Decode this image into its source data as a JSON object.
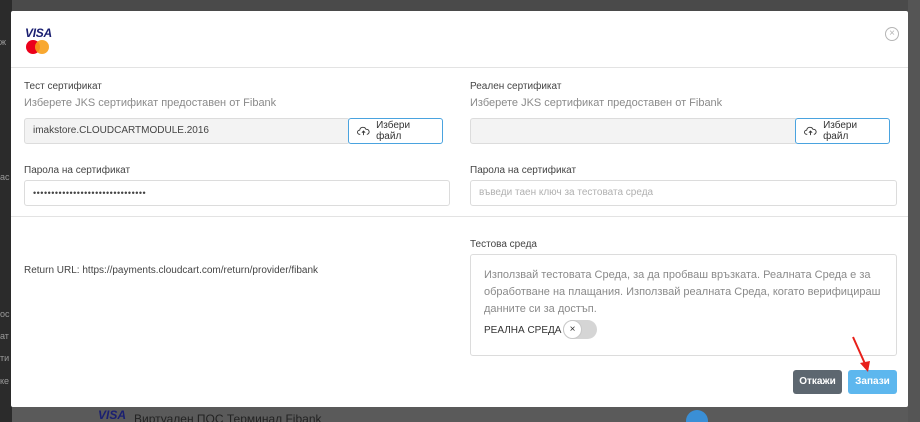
{
  "background": {
    "left_items": [
      "ж",
      "ас",
      "ос",
      "ат",
      "ти",
      "ке"
    ],
    "bottom_row": {
      "visa": "VISA",
      "label": "Виртуален ПОС Терминал Fibank"
    }
  },
  "header": {
    "logo_visa": "VISA",
    "logo_mastercard": "mastercard",
    "close_icon": "×"
  },
  "test_cert": {
    "label": "Тест сертификат",
    "hint": "Изберете JKS сертификат предоставен от Fibank",
    "file_value": "imakstore.CLOUDCARTMODULE.2016",
    "button_label": "Избери файл"
  },
  "real_cert": {
    "label": "Реален сертификат",
    "hint": "Изберете JKS сертификат предоставен от Fibank",
    "file_value": "",
    "button_label": "Избери файл"
  },
  "test_password": {
    "label": "Парола на сертификат",
    "value": "•••••••••••••••••••••••••••••••"
  },
  "real_password": {
    "label": "Парола на сертификат",
    "placeholder": "въведи таен ключ за тестовата среда"
  },
  "return_url": "Return URL: https://payments.cloudcart.com/return/provider/fibank",
  "environment": {
    "label": "Тестова среда",
    "description": "Използвай тестовата Среда, за да пробваш връзката. Реалната Среда е за обработване на плащания. Използвай реалната Среда, когато верифицираш данните си за достъп.",
    "toggle_label": "РЕАЛНА СРЕДА",
    "toggle_knob": "×",
    "toggle_on": false
  },
  "actions": {
    "cancel_label": "Откажи",
    "save_label": "Запази"
  },
  "colors": {
    "accent": "#4aa3df",
    "save": "#5db7ee",
    "cancel": "#5d6770",
    "arrow": "#e8201a"
  }
}
